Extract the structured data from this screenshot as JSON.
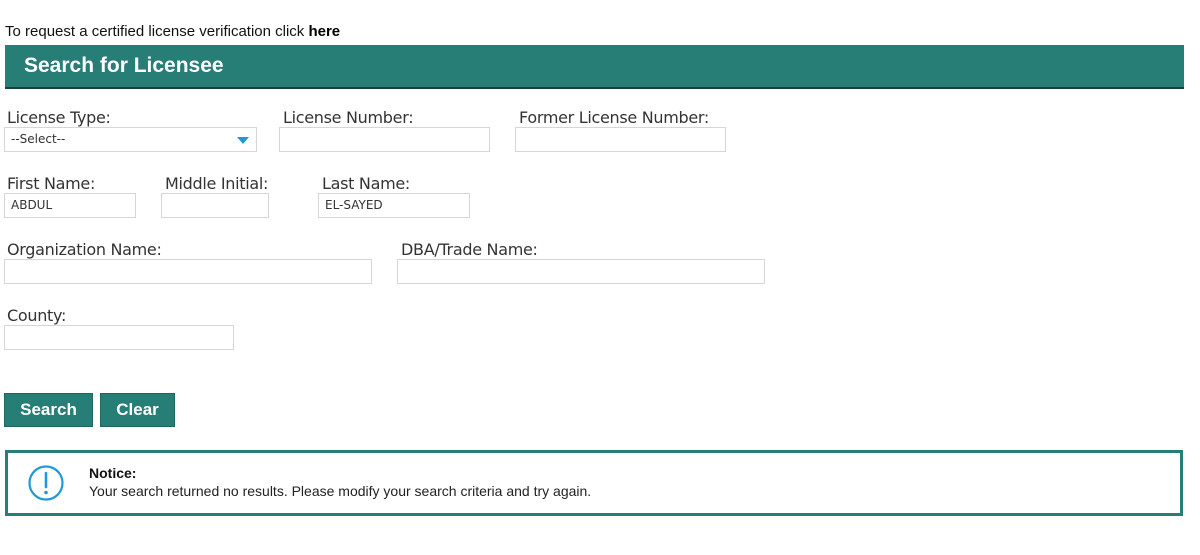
{
  "intro": {
    "text": "To request a certified license verification click ",
    "link_label": "here"
  },
  "header": {
    "title": "Search for Licensee"
  },
  "form": {
    "license_type": {
      "label": "License Type:",
      "value": "--Select--"
    },
    "license_number": {
      "label": "License Number:",
      "value": ""
    },
    "former_license_number": {
      "label": "Former License Number:",
      "value": ""
    },
    "first_name": {
      "label": "First Name:",
      "value": "ABDUL"
    },
    "middle_initial": {
      "label": "Middle Initial:",
      "value": ""
    },
    "last_name": {
      "label": "Last Name:",
      "value": "EL-SAYED"
    },
    "organization_name": {
      "label": "Organization Name:",
      "value": ""
    },
    "dba_trade_name": {
      "label": "DBA/Trade Name:",
      "value": ""
    },
    "county": {
      "label": "County:",
      "value": ""
    }
  },
  "buttons": {
    "search_label": "Search",
    "clear_label": "Clear"
  },
  "notice": {
    "icon": "info-icon",
    "title": "Notice:",
    "message": "Your search returned no results. Please modify your search criteria and try again."
  },
  "colors": {
    "accent": "#277e77",
    "select_caret": "#1f9ad6",
    "notice_icon": "#1f9ad6"
  }
}
